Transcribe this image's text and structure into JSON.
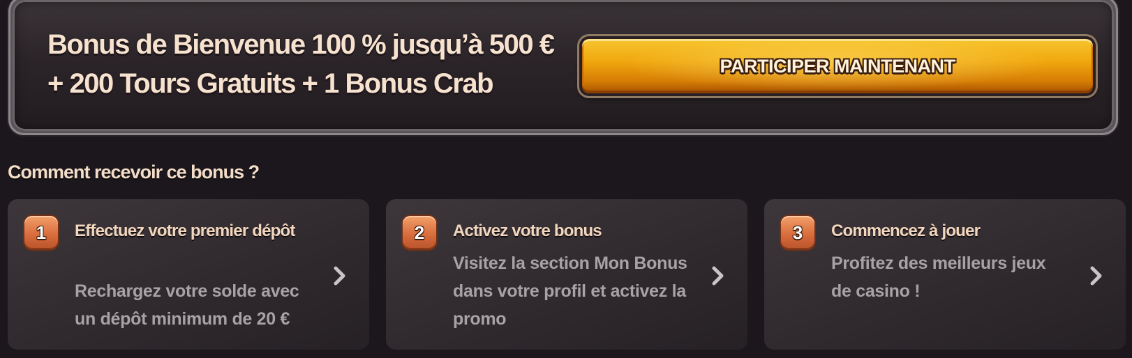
{
  "banner": {
    "title_line1": "Bonus de Bienvenue 100 % jusqu’à 500 €",
    "title_line2": "+ 200 Tours Gratuits + 1 Bonus Crab",
    "cta_label": "PARTICIPER MAINTENANT"
  },
  "how_to": {
    "title": "Comment recevoir ce bonus ?",
    "steps": [
      {
        "number": "1",
        "title": "Effectuez votre premier dépôt",
        "description": "Rechargez votre solde avec un dépôt minimum de 20 €",
        "icon": "chevron-right-icon"
      },
      {
        "number": "2",
        "title": "Activez votre bonus",
        "description": "Visitez la section Mon Bonus dans votre profil et activez la promo",
        "icon": "chevron-right-icon"
      },
      {
        "number": "3",
        "title": "Commencez à jouer",
        "description": "Profitez des meilleurs jeux de casino !",
        "icon": "chevron-right-icon"
      }
    ]
  },
  "colors": {
    "background": "#1b171c",
    "cta_gold": "#f1a80e",
    "step_badge": "#d6693a",
    "heading_text": "#f2d6bd",
    "muted_text": "#a8a2a6"
  }
}
